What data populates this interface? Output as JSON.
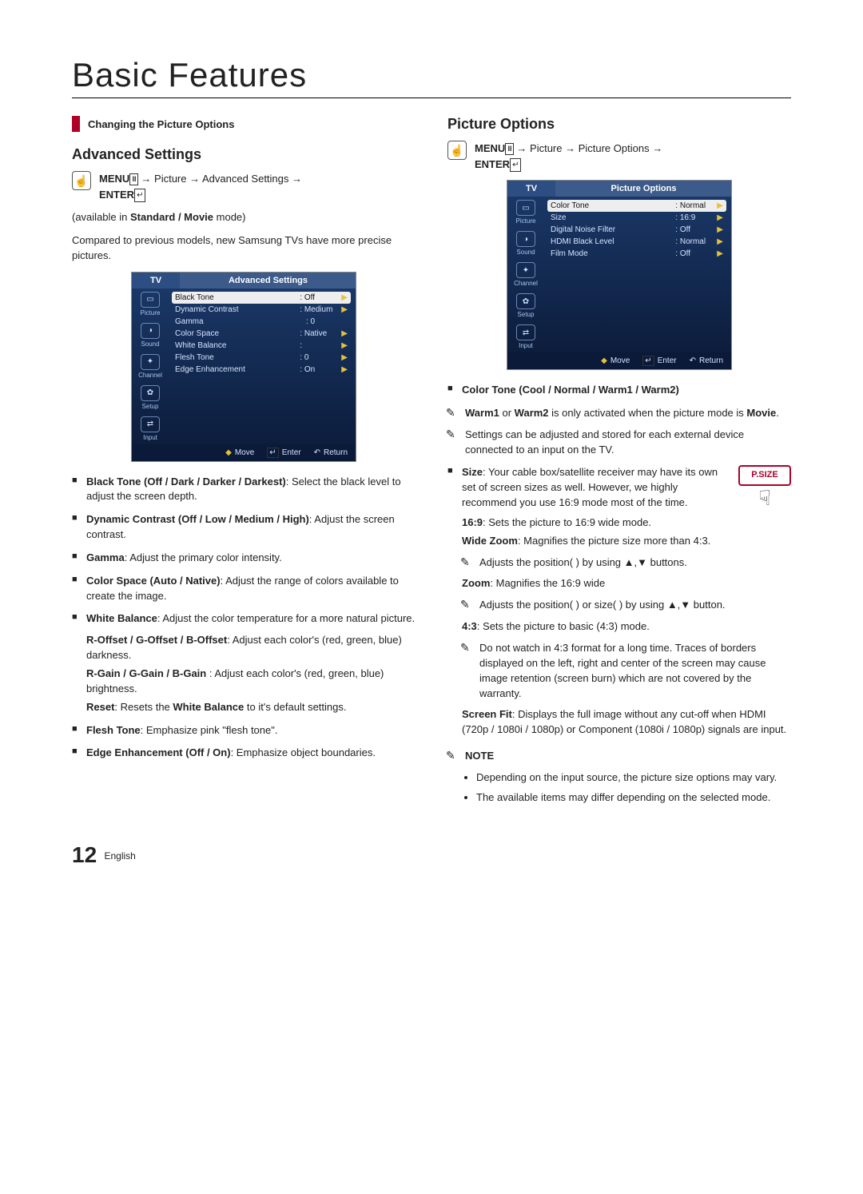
{
  "page": {
    "title": "Basic Features",
    "footer_number": "12",
    "footer_lang": "English"
  },
  "left": {
    "section_bar": "Changing the Picture Options",
    "h2": "Advanced Settings",
    "menu_path_html": "MENU → Picture → Advanced Settings → ENTER",
    "menu_label": "MENU",
    "menu_path_mid": " → Picture → Advanced Settings →",
    "enter_label": "ENTER",
    "availability_prefix": "(available in ",
    "availability_bold": "Standard / Movie",
    "availability_suffix": " mode)",
    "intro": "Compared to previous models, new Samsung TVs have more precise pictures.",
    "osd": {
      "tv": "TV",
      "title": "Advanced Settings",
      "side": [
        "Picture",
        "Sound",
        "Channel",
        "Setup",
        "Input"
      ],
      "rows": [
        {
          "label": "Black Tone",
          "val": ": Off",
          "arrow": true,
          "selected": true
        },
        {
          "label": "Dynamic Contrast",
          "val": ": Medium",
          "arrow": true
        },
        {
          "label": "Gamma",
          "val": ":   0",
          "arrow": false
        },
        {
          "label": "Color Space",
          "val": ": Native",
          "arrow": true
        },
        {
          "label": "White Balance",
          "val": ":",
          "arrow": true
        },
        {
          "label": "Flesh Tone",
          "val": ":   0",
          "arrow": true
        },
        {
          "label": "Edge Enhancement",
          "val": ": On",
          "arrow": true
        }
      ],
      "footer": {
        "move": "Move",
        "enter": "Enter",
        "return": "Return"
      }
    },
    "items": {
      "black_tone_b": "Black Tone (Off / Dark / Darker / Darkest)",
      "black_tone_t": ": Select the black level to adjust the screen depth.",
      "dyn_b": "Dynamic Contrast (Off / Low / Medium / High)",
      "dyn_t": ": Adjust the screen contrast.",
      "gamma_b": "Gamma",
      "gamma_t": ": Adjust the primary color intensity.",
      "cspace_b": "Color Space (Auto / Native)",
      "cspace_t": ": Adjust the range of colors available to create the image.",
      "wb_b": "White Balance",
      "wb_t": ": Adjust the color temperature for a more natural picture.",
      "rgb_offset_b": "R-Offset / G-Offset / B-Offset",
      "rgb_offset_t": ": Adjust each color's (red, green, blue) darkness.",
      "rgb_gain_b": "R-Gain / G-Gain / B-Gain",
      "rgb_gain_t": " : Adjust each color's (red, green, blue) brightness.",
      "reset_b": "Reset",
      "reset_mid": ": Resets the ",
      "reset_b2": "White Balance",
      "reset_t": " to it's default settings.",
      "flesh_b": "Flesh Tone",
      "flesh_t": ": Emphasize pink \"flesh tone\".",
      "edge_b": "Edge Enhancement (Off / On)",
      "edge_t": ": Emphasize object boundaries."
    }
  },
  "right": {
    "h2": "Picture Options",
    "menu_label": "MENU",
    "menu_path_mid": " → Picture → Picture Options →",
    "enter_label": "ENTER",
    "osd": {
      "tv": "TV",
      "title": "Picture Options",
      "side": [
        "Picture",
        "Sound",
        "Channel",
        "Setup",
        "Input"
      ],
      "rows": [
        {
          "label": "Color Tone",
          "val": ": Normal",
          "arrow": true,
          "selected": true
        },
        {
          "label": "Size",
          "val": ": 16:9",
          "arrow": true
        },
        {
          "label": "Digital Noise Filter",
          "val": ": Off",
          "arrow": true
        },
        {
          "label": "HDMI Black Level",
          "val": ": Normal",
          "arrow": true
        },
        {
          "label": "Film Mode",
          "val": ": Off",
          "arrow": true
        }
      ],
      "footer": {
        "move": "Move",
        "enter": "Enter",
        "return": "Return"
      }
    },
    "ct_b": "Color Tone (Cool / Normal / Warm1 / Warm2)",
    "ct_note1_b1": "Warm1",
    "ct_note1_mid": " or ",
    "ct_note1_b2": "Warm2",
    "ct_note1_t": " is only activated when the picture mode is ",
    "ct_note1_b3": "Movie",
    "ct_note1_end": ".",
    "ct_note2": "Settings can be adjusted and stored for each external device connected to an input on the TV.",
    "psize": "P.SIZE",
    "size_b": "Size",
    "size_t": ": Your cable box/satellite receiver may have its own set of screen sizes as well. However, we highly recommend you use 16:9 mode most of the time.",
    "r169_b": "16:9",
    "r169_t": ": Sets the picture to 16:9 wide mode.",
    "wz_b": "Wide Zoom",
    "wz_t": ": Magnifies the picture size more than 4:3.",
    "wz_note": "Adjusts the position(    ) by using ▲,▼ buttons.",
    "zoom_b": "Zoom",
    "zoom_t": ": Magnifies the 16:9 wide",
    "zoom_note": "Adjusts the position(    ) or size(    ) by using ▲,▼ button.",
    "r43_b": "4:3",
    "r43_t": ": Sets the picture to basic (4:3) mode.",
    "r43_note": "Do not watch in 4:3 format for a long time. Traces of borders displayed on the left, right and center of the screen may cause image retention (screen burn) which are not covered by the warranty.",
    "sf_b": "Screen Fit",
    "sf_t": ": Displays the full image without any cut-off when HDMI (720p / 1080i / 1080p) or Component (1080i / 1080p) signals are input.",
    "note_heading": "NOTE",
    "note1": "Depending on the input source, the picture size options may vary.",
    "note2": "The available items may differ depending on the selected mode."
  }
}
